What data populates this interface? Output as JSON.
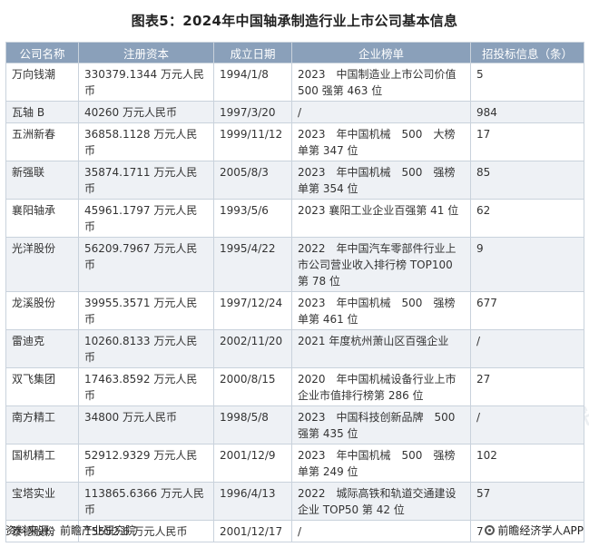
{
  "title": "图表5：2024年中国轴承制造行业上市公司基本信息",
  "watermark_text": "前瞻产业研究院",
  "table": {
    "headers": [
      "公司名称",
      "注册资本",
      "成立日期",
      "企业榜单",
      "招投标信息（条）"
    ],
    "rows": [
      [
        "万向钱潮",
        "330379.1344 万元人民币",
        "1994/1/8",
        "2023　中国制造业上市公司价值 500 强第 463 位",
        "5"
      ],
      [
        "瓦轴 B",
        "40260 万元人民币",
        "1997/3/20",
        "/",
        "984"
      ],
      [
        "五洲新春",
        "36858.1128 万元人民币",
        "1999/11/12",
        "2023　年中国机械　500　大榜单第 347 位",
        "17"
      ],
      [
        "新强联",
        "35874.1711 万元人民币",
        "2005/8/3",
        "2023　年中国机械　500　强榜单第 354 位",
        "85"
      ],
      [
        "襄阳轴承",
        "45961.1797 万元人民币",
        "1993/5/6",
        "2023 襄阳工业企业百强第 41 位",
        "62"
      ],
      [
        "光洋股份",
        "56209.7967 万元人民币",
        "1995/4/22",
        "2022　年中国汽车零部件行业上市公司营业收入排行榜 TOP100 第 78 位",
        "9"
      ],
      [
        "龙溪股份",
        "39955.3571 万元人民币",
        "1997/12/24",
        "2023　年中国机械　500　强榜单第 461 位",
        "677"
      ],
      [
        "雷迪克",
        "10260.8133 万元人民币",
        "2002/11/20",
        "2021 年度杭州萧山区百强企业",
        "/"
      ],
      [
        "双飞集团",
        "17463.8592 万元人民币",
        "2000/8/15",
        "2020　年中国机械设备行业上市企业市值排行榜第 286 位",
        "27"
      ],
      [
        "南方精工",
        "34800 万元人民币",
        "1998/5/8",
        "2023　中国科技创新品牌　500　强第 435 位",
        "/"
      ],
      [
        "国机精工",
        "52912.9329 万元人民币",
        "2001/12/9",
        "2023　年中国机械　500　强榜单第 249 位",
        "102"
      ],
      [
        "宝塔实业",
        "113865.6366 万元人民币",
        "1996/4/13",
        "2022　城际高铁和轨道交通建设企业 TOP50 第 42 位",
        "57"
      ],
      [
        "泰德股份",
        "15552.6 万元人民币",
        "2001/12/17",
        "/",
        "7"
      ]
    ]
  },
  "footer": {
    "source": "资料来源：前瞻产业研究院",
    "brand": "前瞻经济学人APP"
  },
  "colors": {
    "header_bg": "#8aa0ba",
    "row_alt_bg": "#eef1f5",
    "border": "#c9d2dc"
  }
}
